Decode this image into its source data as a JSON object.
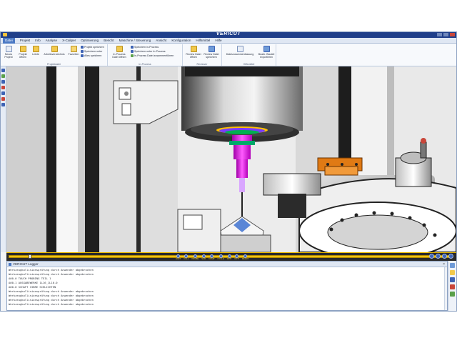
{
  "titlebar": {
    "title": "VERICUT"
  },
  "menu": {
    "tabs": [
      {
        "label": "Datei",
        "active": true
      },
      {
        "label": "Projekt"
      },
      {
        "label": "Info"
      },
      {
        "label": "Analyse"
      },
      {
        "label": "X-Caliper"
      },
      {
        "label": "Optimierung"
      },
      {
        "label": "Bericht"
      },
      {
        "label": "Maschine / Steuerung"
      },
      {
        "label": "Ansicht"
      },
      {
        "label": "Konfiguration"
      },
      {
        "label": "Hilfsmittel"
      },
      {
        "label": "Hilfe"
      }
    ]
  },
  "ribbon": {
    "projektdatei": {
      "caption": "Projektdatei",
      "neues_projekt": "Neues Projekt",
      "projekt_oeffnen": "Projekt öffnen",
      "letzte": "Letzte",
      "arbeitsverzeichnis": "Arbeitsverzeichnis",
      "favoriten": "Favoriten",
      "projekt_speichern": "Projekt speichern",
      "speichern_unter": "Speichern unter",
      "alles_speichern": "Alles speichern"
    },
    "inprozess": {
      "caption": "In-Prozess",
      "inprozess_oeffnen": "In-Prozess Datei öffnen",
      "speichern_inprozess": "Speichern in-Prozess",
      "speichern_unter_inprozess": "Speichern unter In-Prozess",
      "zusammenfuehren": "In-Prozess Datei zusammenführen"
    },
    "reviewer": {
      "caption": "Reviewer",
      "review_oeffnen": "Review Datei öffnen",
      "review_speichern": "Review Datei speichern"
    },
    "hilfsmittel": {
      "caption": "Hilfsmittel",
      "dateizusammenfassung": "Dateizusammenfassung",
      "bearb_bauteil": "Bearb. Bauteil exportieren"
    }
  },
  "simbar": {
    "progress": 0.045,
    "controls": [
      "LIMIT",
      "COLL",
      "PROBE",
      "SUB",
      "COMP",
      "CYCLE",
      "OPTI",
      "OPTI",
      "READY"
    ]
  },
  "logger": {
    "title": "VERICUT Logger",
    "lines": [
      "Werkzeugkollisionsprüfung durch Anwender abgebrochen",
      "Werkzeugkollisionsprüfung durch Anwender abgebrochen",
      "A00.0 TOUCH PROBING TEIL 1",
      "A00.1 AUSGABEWERKE 1L16_1L10.0",
      "A00.0 SCHAFT VIBRE SCHLICHTEN",
      "Werkzeugkollisionsprüfung durch Anwender abgebrochen",
      "Werkzeugkollisionsprüfung durch Anwender abgebrochen",
      "Werkzeugkollisionsprüfung durch Anwender abgebrochen",
      "Werkzeugkollisionsprüfung durch Anwender abgebrochen"
    ]
  },
  "colors": {
    "titlebar": "#1f3f8a",
    "simbar_accent": "#f1c40f",
    "tool_magenta": "#e600e6",
    "fixture_orange": "#e07a14"
  }
}
